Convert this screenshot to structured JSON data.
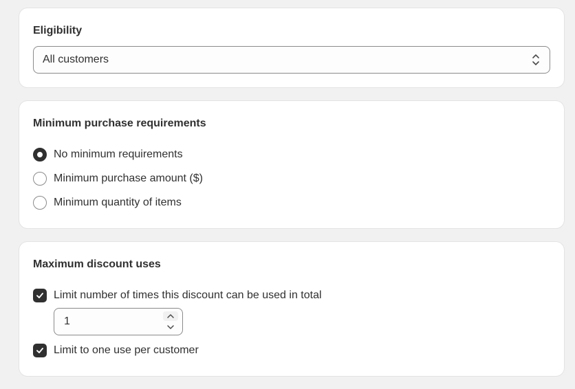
{
  "eligibility": {
    "title": "Eligibility",
    "selected": "All customers"
  },
  "minimum_purchase": {
    "title": "Minimum purchase requirements",
    "options": [
      {
        "label": "No minimum requirements",
        "checked": true
      },
      {
        "label": "Minimum purchase amount ($)",
        "checked": false
      },
      {
        "label": "Minimum quantity of items",
        "checked": false
      }
    ]
  },
  "max_uses": {
    "title": "Maximum discount uses",
    "limit_total": {
      "label": "Limit number of times this discount can be used in total",
      "checked": true
    },
    "total_value": "1",
    "limit_per_customer": {
      "label": "Limit to one use per customer",
      "checked": true
    }
  },
  "icons": {
    "select": "chevron-up-down-icon",
    "checkbox": "checkmark-icon",
    "stepper_up": "chevron-up-icon",
    "stepper_down": "chevron-down-icon"
  },
  "colors": {
    "background": "#f1f1f1",
    "card": "#ffffff",
    "text": "#303030",
    "control_border": "#8a8a8a",
    "checked_fill": "#303030"
  }
}
